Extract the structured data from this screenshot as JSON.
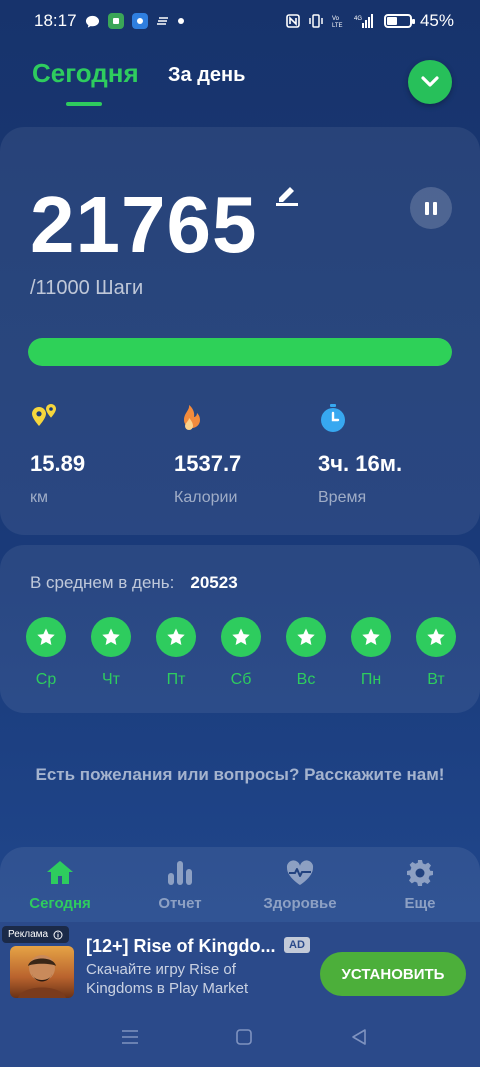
{
  "status_bar": {
    "time": "18:17",
    "battery": "45%",
    "battery_level": 0.45
  },
  "tabs": {
    "today": "Сегодня",
    "by_day": "За день"
  },
  "steps": {
    "value": "21765",
    "goal": "/11000",
    "unit": "Шаги",
    "progress_fraction": 1.0
  },
  "stats": [
    {
      "value": "15.89",
      "label": "км",
      "icon": "location-icon",
      "color": "#f5d63d"
    },
    {
      "value": "1537.7",
      "label": "Калории",
      "icon": "flame-icon",
      "color": "#f38b3c"
    },
    {
      "value": "3ч. 16м.",
      "label": "Время",
      "icon": "stopwatch-icon",
      "color": "#37a8f0"
    }
  ],
  "average": {
    "label": "В среднем в день:",
    "value": "20523"
  },
  "days": [
    "Ср",
    "Чт",
    "Пт",
    "Сб",
    "Вс",
    "Пн",
    "Вт"
  ],
  "feedback": "Есть пожелания или вопросы? Расскажите нам!",
  "nav": [
    {
      "label": "Сегодня",
      "icon": "home-icon",
      "active": true
    },
    {
      "label": "Отчет",
      "icon": "bar-chart-icon",
      "active": false
    },
    {
      "label": "Здоровье",
      "icon": "heart-pulse-icon",
      "active": false
    },
    {
      "label": "Еще",
      "icon": "gear-icon",
      "active": false
    }
  ],
  "ad": {
    "badge": "Реклама",
    "title": "[12+] Rise of Kingdo...",
    "tag": "AD",
    "description": "Скачайте игру Rise of Kingdoms в Play Market",
    "cta": "УСТАНОВИТЬ"
  },
  "colors": {
    "accent": "#2ecc5e",
    "background": "#1a3b7a"
  }
}
